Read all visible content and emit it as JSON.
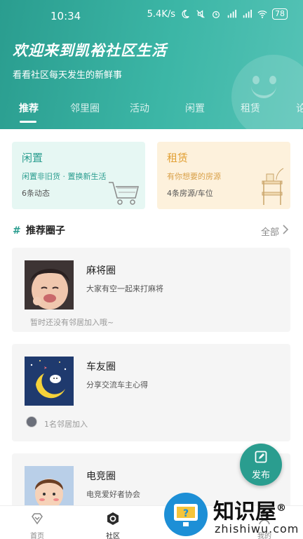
{
  "status_bar": {
    "time": "10:34",
    "speed": "5.4K/s",
    "network1": "HD",
    "network2": "HD",
    "battery": "78"
  },
  "header": {
    "title": "欢迎来到凯裕社区生活",
    "subtitle": "看看社区每天发生的新鲜事",
    "tabs": [
      "推荐",
      "邻里圈",
      "活动",
      "闲置",
      "租赁",
      "论"
    ],
    "active_tab": "推荐"
  },
  "feature_cards": [
    {
      "title": "闲置",
      "desc": "闲置非旧货 · 置换新生活",
      "count": "6条动态",
      "icon": "shopping-cart-icon"
    },
    {
      "title": "租赁",
      "desc": "有你想要的房源",
      "count": "4条房源/车位",
      "icon": "shelf-icon"
    }
  ],
  "section": {
    "hash": "#",
    "title": "推荐圈子",
    "all_label": "全部"
  },
  "circles": [
    {
      "name": "麻将圈",
      "desc": "大家有空一起来打麻将",
      "footer": "暂时还没有邻居加入哦~"
    },
    {
      "name": "车友圈",
      "desc": "分享交流车主心得",
      "footer": "1名邻居加入"
    },
    {
      "name": "电竞圈",
      "desc": "电竞爱好者协会",
      "footer": ""
    }
  ],
  "fab": {
    "label": "发布",
    "icon": "edit-icon"
  },
  "bottom_nav": [
    {
      "label": "首页",
      "icon": "diamond-home-icon"
    },
    {
      "label": "社区",
      "icon": "hexagon-community-icon"
    },
    {
      "label": "",
      "icon": ""
    },
    {
      "label": "",
      "icon": ""
    },
    {
      "label": "我的",
      "icon": "person-icon"
    }
  ],
  "watermark": {
    "text": "知识屋",
    "mark": "®",
    "url": "zhishiwu.com"
  },
  "colors": {
    "primary": "#2a9d8f",
    "card_green_bg": "#e6f7f3",
    "card_yellow_bg": "#fdf1dc",
    "accent_orange": "#e2a136"
  }
}
